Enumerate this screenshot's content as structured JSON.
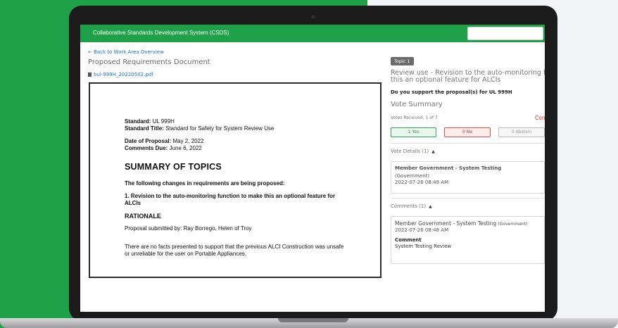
{
  "app": {
    "title": "Collaborative Standards Development System (CSDS)",
    "search_placeholder": ""
  },
  "left": {
    "back_link": "← Back to Work Area Overview",
    "title": "Proposed Requirements Document",
    "file_name": "bul-999H_20220502.pdf"
  },
  "doc": {
    "standard_label": "Standard:",
    "standard_value": "UL 999H",
    "standard_title_label": "Standard Title:",
    "standard_title_value": "Standard for Safety for System Review Use",
    "date_label": "Date of Proposal:",
    "date_value": "May 2, 2022",
    "due_label": "Comments Due:",
    "due_value": "June 6, 2022",
    "summary_heading": "SUMMARY OF TOPICS",
    "changes_intro": "The following changes in requirements are being proposed:",
    "item1": "1. Revision to the auto-monitoring function to make this an optional feature for ALCIs",
    "rationale_heading": "RATIONALE",
    "submitted_by": "Proposal submitted by: Ray Borrego, Helen of Troy",
    "paragraph": "There are no facts presented to support that the previous ALCI Construction was unsafe or unreliable for the user on Portable Appliances."
  },
  "right": {
    "topic_badge": "Topic 1",
    "topic_title": "Review use - Revision to the auto-monitoring fu this an optional feature for ALCIs",
    "question": "Do you support the proposal(s) for UL 999H",
    "vote_summary_title": "Vote Summary",
    "votes_received": "Votes Received: 1 of 7",
    "con_label": "Con",
    "yes_label": "1 Yes",
    "no_label": "0 No",
    "abstain_label": "0 Abstain",
    "vote_details_label": "Vote Details (1)",
    "vote_member": "Member Government - System Testing",
    "vote_role": "(Government)",
    "vote_time": "2022-07-26 08:48 AM",
    "comments_label": "Comments (1)",
    "comment_member": "Member Government - System Testing",
    "comment_role": "(Government)",
    "comment_time": "2022-07-26 08:48 AM",
    "comment_heading": "Comment",
    "comment_text": "System Testing Review"
  }
}
